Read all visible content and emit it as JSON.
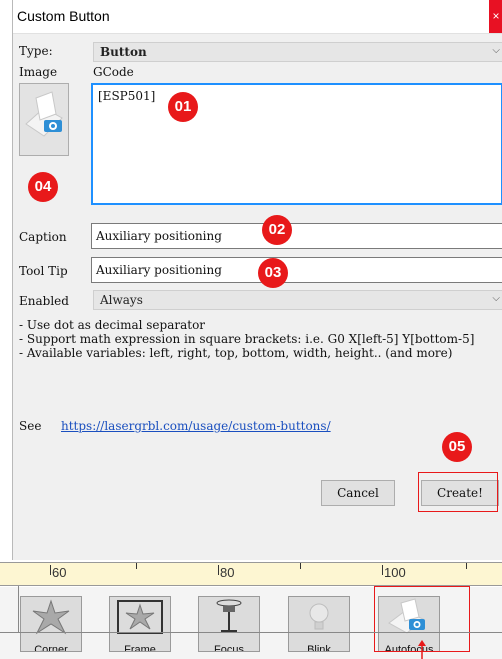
{
  "dialog": {
    "title": "Custom Button",
    "close_glyph": "×",
    "type_label": "Type:",
    "type_value": "Button",
    "image_label": "Image",
    "gcode_label": "GCode",
    "gcode_value": "[ESP501]",
    "caption_label": "Caption",
    "caption_value": "Auxiliary positioning",
    "tooltip_label": "Tool Tip",
    "tooltip_value": "Auxiliary positioning",
    "enabled_label": "Enabled",
    "enabled_value": "Always",
    "info_text": "- Use dot as decimal separator\n- Support math expression in square brackets: i.e. G0 X[left-5] Y[bottom-5]\n- Available variables: left, right, top, bottom, width, height.. (and more)",
    "see_label": "See",
    "link_text": "https://lasergrbl.com/usage/custom-buttons/",
    "cancel_label": "Cancel",
    "create_label": "Create!"
  },
  "badges": [
    "01",
    "02",
    "03",
    "04",
    "05"
  ],
  "ruler": {
    "ticks": [
      "60",
      "80",
      "100"
    ]
  },
  "toolbar": {
    "buttons": [
      {
        "label": "Corner",
        "icon": "starfish-icon"
      },
      {
        "label": "Frame",
        "icon": "frame-icon"
      },
      {
        "label": "Focus",
        "icon": "focus-icon"
      },
      {
        "label": "Blink",
        "icon": "lightbulb-icon"
      },
      {
        "label": "Autofocus",
        "icon": "autofocus-icon"
      }
    ]
  },
  "colors": {
    "annotation_red": "#e8191a",
    "focus_blue": "#1e90ff",
    "link_blue": "#1a4fbf",
    "ruler_bg": "#fdf6d2"
  }
}
